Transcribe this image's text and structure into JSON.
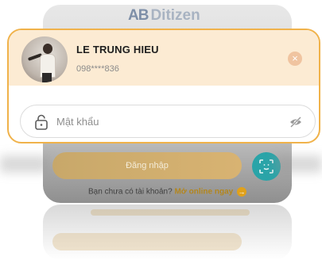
{
  "brand": {
    "logo_mark": "AB",
    "logo_text": "Ditizen"
  },
  "account": {
    "name": "LE TRUNG HIEU",
    "phone": "098****836",
    "remove_icon": "close-icon"
  },
  "password": {
    "placeholder": "Mật khẩu",
    "lock_icon": "lock-icon",
    "visibility_icon": "eye-off-icon"
  },
  "actions": {
    "login_label": "Đăng nhập",
    "face_id_icon": "face-scan-icon",
    "signup_prompt": "Bạn chưa có tài khoản?",
    "signup_link": "Mở online ngay",
    "signup_arrow": "→"
  },
  "colors": {
    "accent": "#f0b24a",
    "account_bg": "#fcebd3",
    "login_button": "#d8b372",
    "face_button": "#2aa4a8",
    "link": "#b3861d"
  }
}
